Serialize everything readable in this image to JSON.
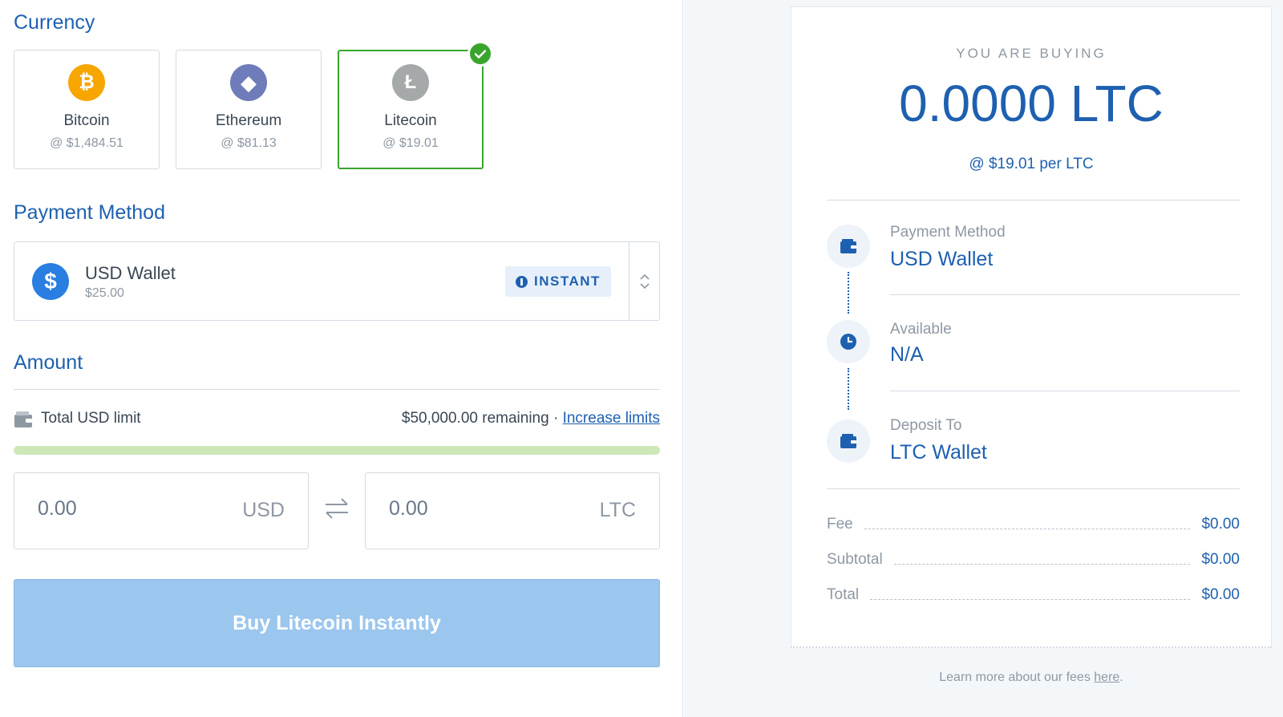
{
  "currency": {
    "title": "Currency",
    "options": [
      {
        "name": "Bitcoin",
        "price": "@ $1,484.51",
        "symbol": "₿",
        "color": "#f7a600",
        "icon": "bitcoin-icon"
      },
      {
        "name": "Ethereum",
        "price": "@ $81.13",
        "symbol": "◆",
        "color": "#6f7cba",
        "icon": "ethereum-icon"
      },
      {
        "name": "Litecoin",
        "price": "@ $19.01",
        "symbol": "Ł",
        "color": "#a6a9aa",
        "icon": "litecoin-icon"
      }
    ],
    "selected": "Litecoin"
  },
  "payment": {
    "title": "Payment Method",
    "method_name": "USD Wallet",
    "balance": "$25.00",
    "badge": "INSTANT"
  },
  "amount": {
    "title": "Amount",
    "limit_label": "Total USD limit",
    "remaining": "$50,000.00 remaining",
    "separator": "·",
    "increase_link": "Increase limits",
    "limit_progress": 1.0,
    "usd_value": "0.00",
    "usd_unit": "USD",
    "ltc_value": "0.00",
    "ltc_unit": "LTC"
  },
  "buy_button": "Buy Litecoin Instantly",
  "summary": {
    "heading": "YOU ARE BUYING",
    "amount": "0.0000 LTC",
    "rate": "@ $19.01 per LTC",
    "payment_label": "Payment Method",
    "payment_value": "USD Wallet",
    "available_label": "Available",
    "available_value": "N/A",
    "deposit_label": "Deposit To",
    "deposit_value": "LTC Wallet",
    "fee_label": "Fee",
    "fee_value": "$0.00",
    "subtotal_label": "Subtotal",
    "subtotal_value": "$0.00",
    "total_label": "Total",
    "total_value": "$0.00"
  },
  "footer": {
    "note_text": "Learn more about our fees ",
    "note_link": "here",
    "note_end": "."
  },
  "colors": {
    "brand_blue": "#1e60b0",
    "success_green": "#3aa52e",
    "button_disabled": "#9bc6ee"
  }
}
